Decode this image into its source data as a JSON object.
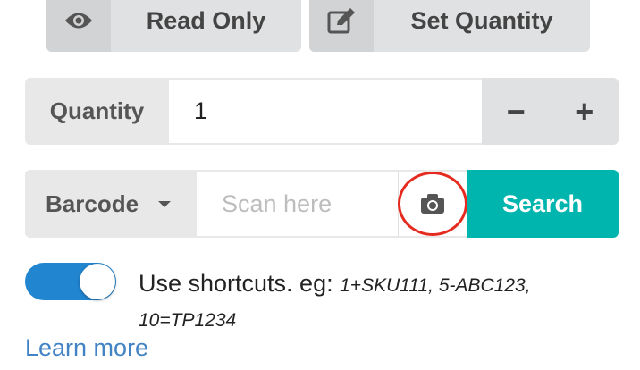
{
  "modes": {
    "read_only": {
      "label": "Read Only",
      "icon": "eye-icon"
    },
    "set_quantity": {
      "label": "Set Quantity",
      "icon": "edit-icon"
    }
  },
  "quantity": {
    "label": "Quantity",
    "value": "1",
    "decrement": "−",
    "increment": "+"
  },
  "barcode": {
    "select_label": "Barcode",
    "placeholder": "Scan here",
    "camera_icon": "camera-icon",
    "search_label": "Search"
  },
  "shortcuts": {
    "enabled": true,
    "label": "Use shortcuts. eg:",
    "examples_line1": "1+SKU111, 5-ABC123,",
    "examples_line2": "10=TP1234"
  },
  "learn_more": "Learn more",
  "colors": {
    "accent_teal": "#00b5ad",
    "toggle_blue": "#2185d0",
    "highlight_red": "#e52b1f",
    "link_blue": "#4183c4"
  }
}
